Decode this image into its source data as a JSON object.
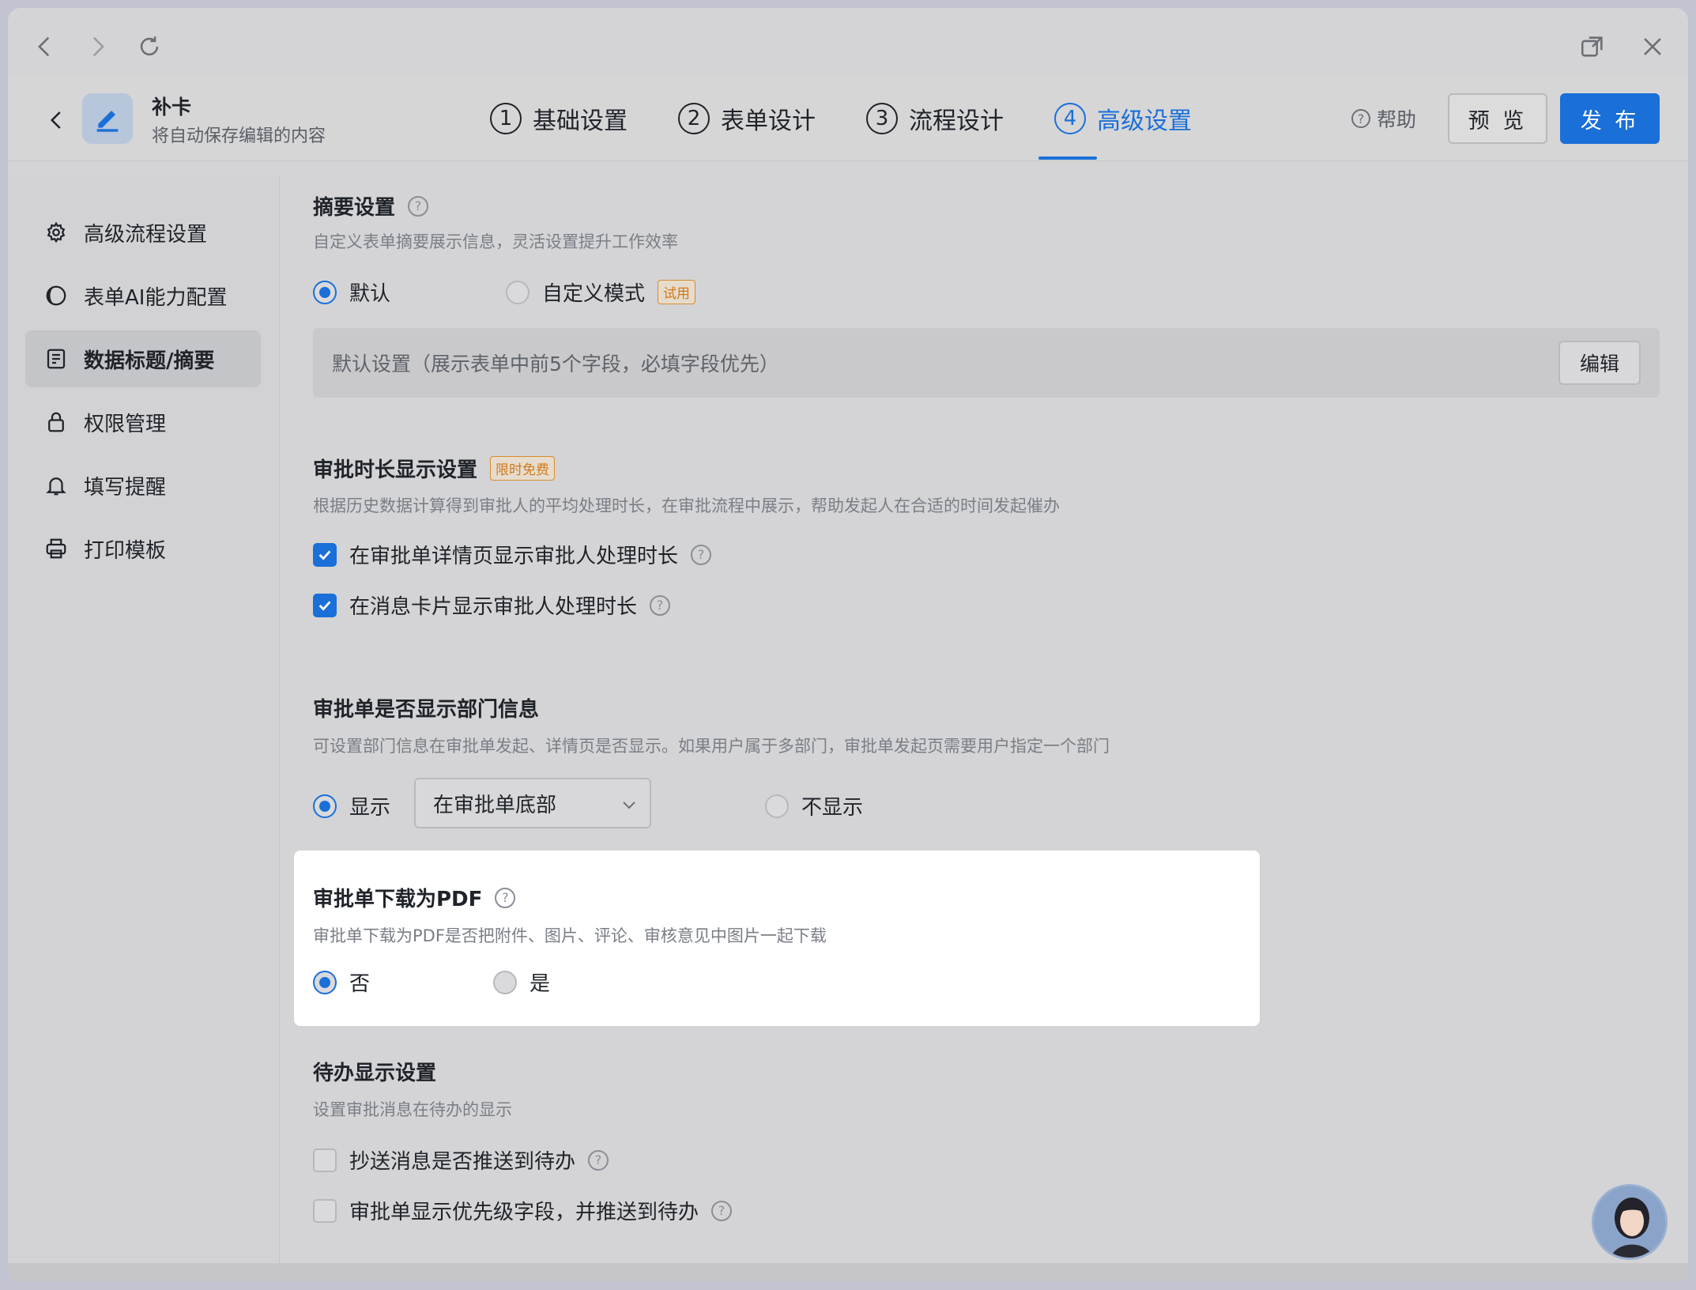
{
  "browser": {
    "back_icon": "chevron-left-icon",
    "forward_icon": "chevron-right-icon",
    "reload_icon": "reload-icon",
    "popout_icon": "open-in-window-icon",
    "close_icon": "close-icon"
  },
  "header": {
    "app_name": "补卡",
    "subtitle": "将自动保存编辑的内容",
    "steps": [
      {
        "num": "1",
        "label": "基础设置"
      },
      {
        "num": "2",
        "label": "表单设计"
      },
      {
        "num": "3",
        "label": "流程设计"
      },
      {
        "num": "4",
        "label": "高级设置"
      }
    ],
    "active_step": 4,
    "help": "帮助",
    "preview": "预 览",
    "publish": "发 布"
  },
  "sidebar": {
    "items": [
      {
        "label": "高级流程设置",
        "icon": "gear-icon"
      },
      {
        "label": "表单AI能力配置",
        "icon": "ai-icon"
      },
      {
        "label": "数据标题/摘要",
        "icon": "document-icon"
      },
      {
        "label": "权限管理",
        "icon": "lock-icon"
      },
      {
        "label": "填写提醒",
        "icon": "bell-icon"
      },
      {
        "label": "打印模板",
        "icon": "printer-icon"
      }
    ],
    "active_index": 2
  },
  "summary": {
    "title": "摘要设置",
    "desc": "自定义表单摘要展示信息，灵活设置提升工作效率",
    "option_default": "默认",
    "option_custom": "自定义模式",
    "custom_tag": "试用",
    "selected": "默认",
    "box_text": "默认设置（展示表单中前5个字段，必填字段优先）",
    "edit": "编辑"
  },
  "duration": {
    "title": "审批时长显示设置",
    "tag": "限时免费",
    "desc": "根据历史数据计算得到审批人的平均处理时长，在审批流程中展示，帮助发起人在合适的时间发起催办",
    "check1": "在审批单详情页显示审批人处理时长",
    "check2": "在消息卡片显示审批人处理时长",
    "check1_checked": true,
    "check2_checked": true
  },
  "department": {
    "title": "审批单是否显示部门信息",
    "desc": "可设置部门信息在审批单发起、详情页是否显示。如果用户属于多部门，审批单发起页需要用户指定一个部门",
    "option_show": "显示",
    "select_value": "在审批单底部",
    "option_hide": "不显示",
    "selected": "显示"
  },
  "pdf": {
    "title": "审批单下载为PDF",
    "desc": "审批单下载为PDF是否把附件、图片、评论、审核意见中图片一起下载",
    "option_no": "否",
    "option_yes": "是",
    "selected": "否"
  },
  "todo": {
    "title": "待办显示设置",
    "desc": "设置审批消息在待办的显示",
    "check1": "抄送消息是否推送到待办",
    "check2": "审批单显示优先级字段，并推送到待办",
    "check1_checked": false,
    "check2_checked": false
  },
  "colors": {
    "accent": "#1a6fd8",
    "tag_orange": "#d07a1a"
  }
}
